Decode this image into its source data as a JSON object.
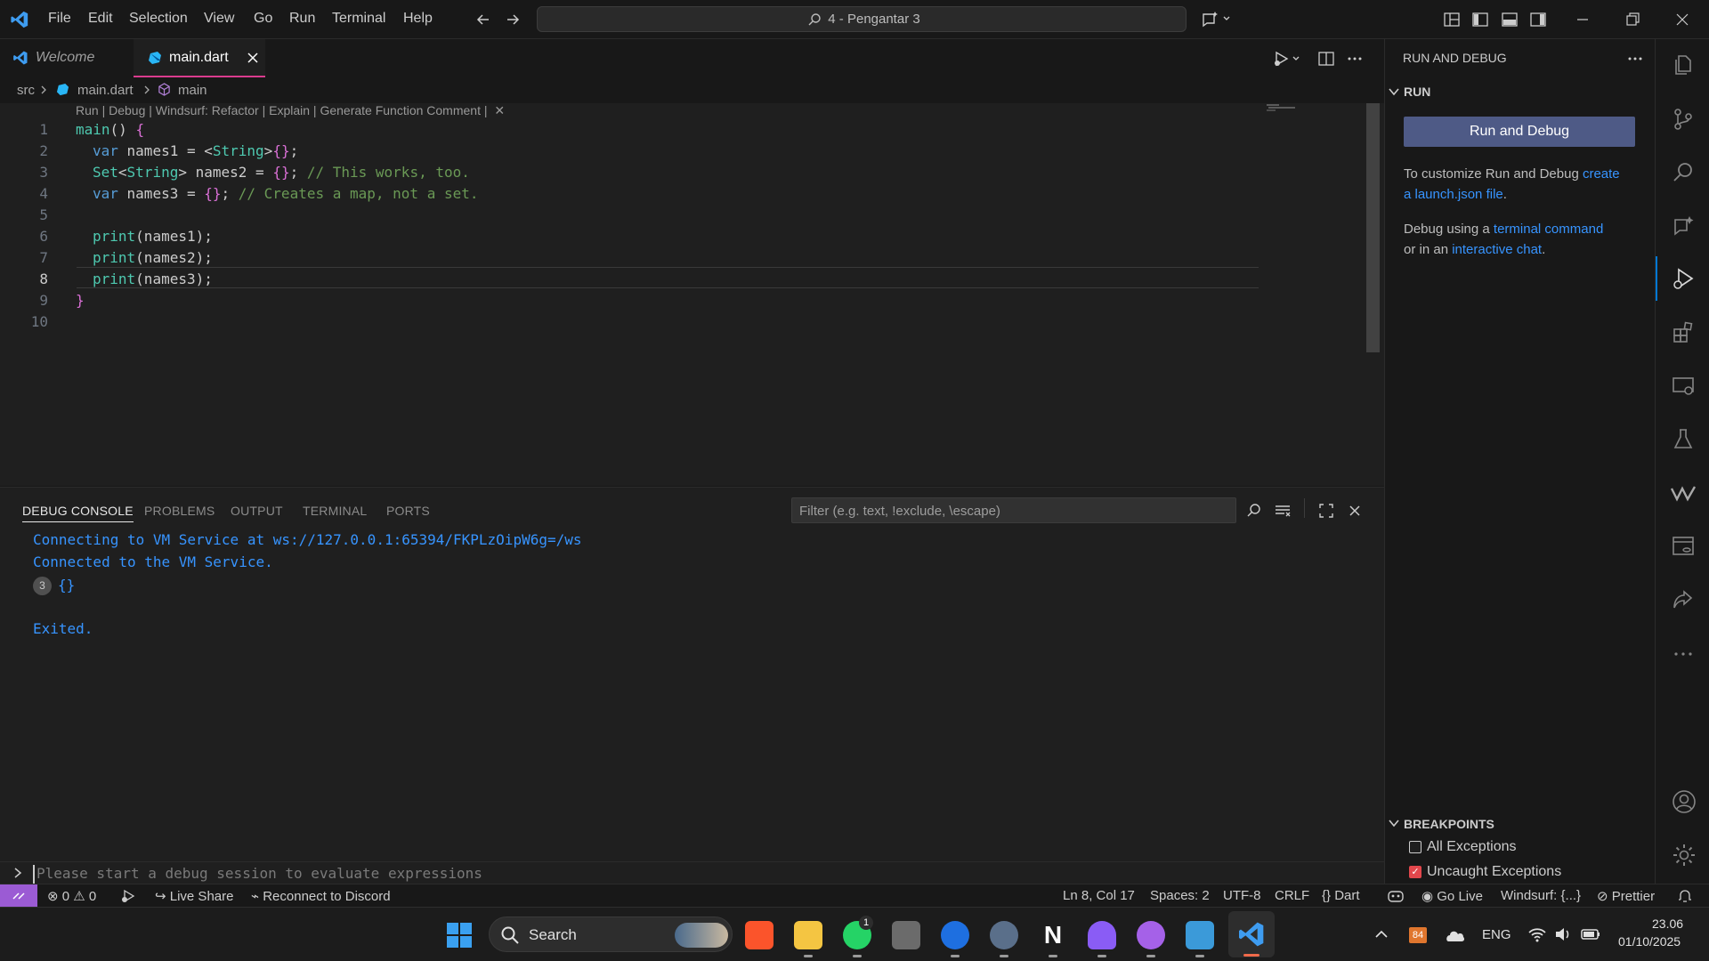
{
  "titlebar": {
    "menu": [
      "File",
      "Edit",
      "Selection",
      "View",
      "Go",
      "Run",
      "Terminal",
      "Help"
    ],
    "command_center": "4 - Pengantar 3"
  },
  "tabs": [
    {
      "label": "Welcome",
      "active": false
    },
    {
      "label": "main.dart",
      "active": true
    }
  ],
  "breadcrumb": {
    "folder": "src",
    "file": "main.dart",
    "symbol": "main"
  },
  "codelens": "Run | Debug | Windsurf: Refactor | Explain | Generate Function Comment |",
  "editor": {
    "line_numbers": [
      "1",
      "2",
      "3",
      "4",
      "5",
      "6",
      "7",
      "8",
      "9",
      "10"
    ],
    "current_line": 8
  },
  "panel": {
    "tabs": [
      "DEBUG CONSOLE",
      "PROBLEMS",
      "OUTPUT",
      "TERMINAL",
      "PORTS"
    ],
    "filter_placeholder": "Filter (e.g. text, !exclude, \\escape)",
    "console_lines": {
      "line1": "Connecting to VM Service at ws://127.0.0.1:65394/FKPLzOipW6g=/ws",
      "line2": "Connected to the VM Service.",
      "repeat_count": "3",
      "line3": "{}",
      "line4": "Exited."
    },
    "eval_placeholder": "Please start a debug session to evaluate expressions"
  },
  "sidebar": {
    "title": "RUN AND DEBUG",
    "section": "RUN",
    "button": "Run and Debug",
    "text1_pre": "To customize Run and Debug ",
    "link1a": "create",
    "link1b": "a launch.json file",
    "text1_post": ".",
    "text2_pre": "Debug using a ",
    "link2": "terminal command",
    "text2_mid": "or in an ",
    "link3": "interactive chat",
    "text2_post": ".",
    "breakpoints_title": "BREAKPOINTS",
    "bp1": "All Exceptions",
    "bp2": "Uncaught Exceptions"
  },
  "statusbar": {
    "errors": "0",
    "warnings": "0",
    "live_share": "Live Share",
    "discord": "Reconnect to Discord",
    "position": "Ln 8, Col 17",
    "spaces": "Spaces: 2",
    "encoding": "UTF-8",
    "eol": "CRLF",
    "language": "Dart",
    "go_live": "Go Live",
    "windsurf": "Windsurf: {...}",
    "prettier": "Prettier"
  },
  "taskbar": {
    "search": "Search",
    "lang": "ENG",
    "time": "23.06",
    "date": "01/10/2025",
    "temp_badge": "84",
    "whatsapp_badge": "1"
  },
  "colors": {
    "accent": "#0078d4",
    "link": "#3794ff",
    "button": "#4e5a86"
  }
}
